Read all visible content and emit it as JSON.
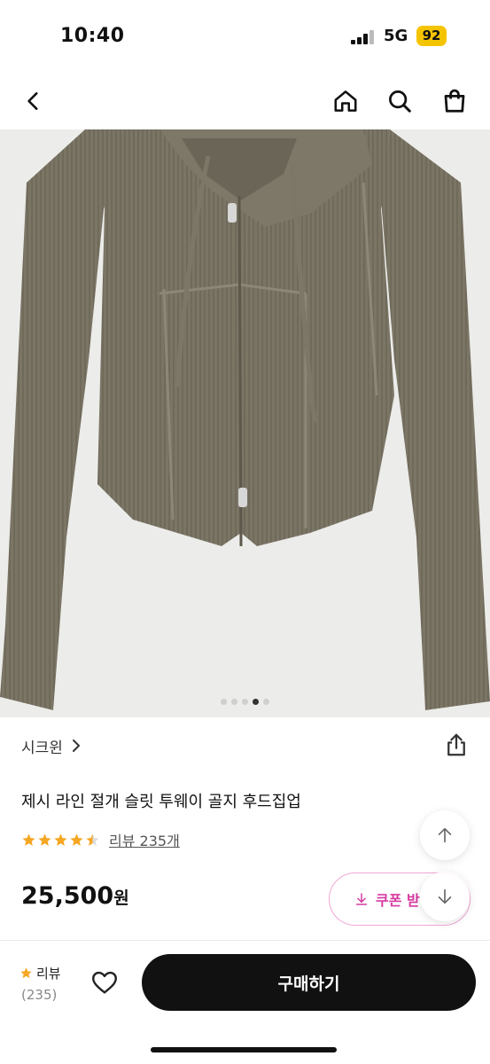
{
  "status": {
    "time": "10:40",
    "network": "5G",
    "battery": "92"
  },
  "icons": {
    "back": "chevron-left-icon",
    "home": "home-icon",
    "search": "search-icon",
    "cart": "shopping-bag-icon",
    "share": "share-icon",
    "heart": "heart-icon",
    "up": "arrow-up-icon",
    "down": "arrow-down-icon"
  },
  "gallery": {
    "dot_count": 5,
    "active_index": 3
  },
  "product": {
    "shop_name": "시크윈",
    "title": "제시 라인 절개 슬릿 투웨이 골지 후드집업",
    "rating": 4.5,
    "review_link": "리뷰 235개",
    "price": "25,500",
    "price_unit": "원",
    "coupon_label": "쿠폰 받"
  },
  "bottom": {
    "review_label": "리뷰",
    "review_count": "(235)",
    "buy_label": "구매하기"
  },
  "colors": {
    "accent_pink": "#d63aa0",
    "star": "#f5a623",
    "button": "#111111"
  }
}
